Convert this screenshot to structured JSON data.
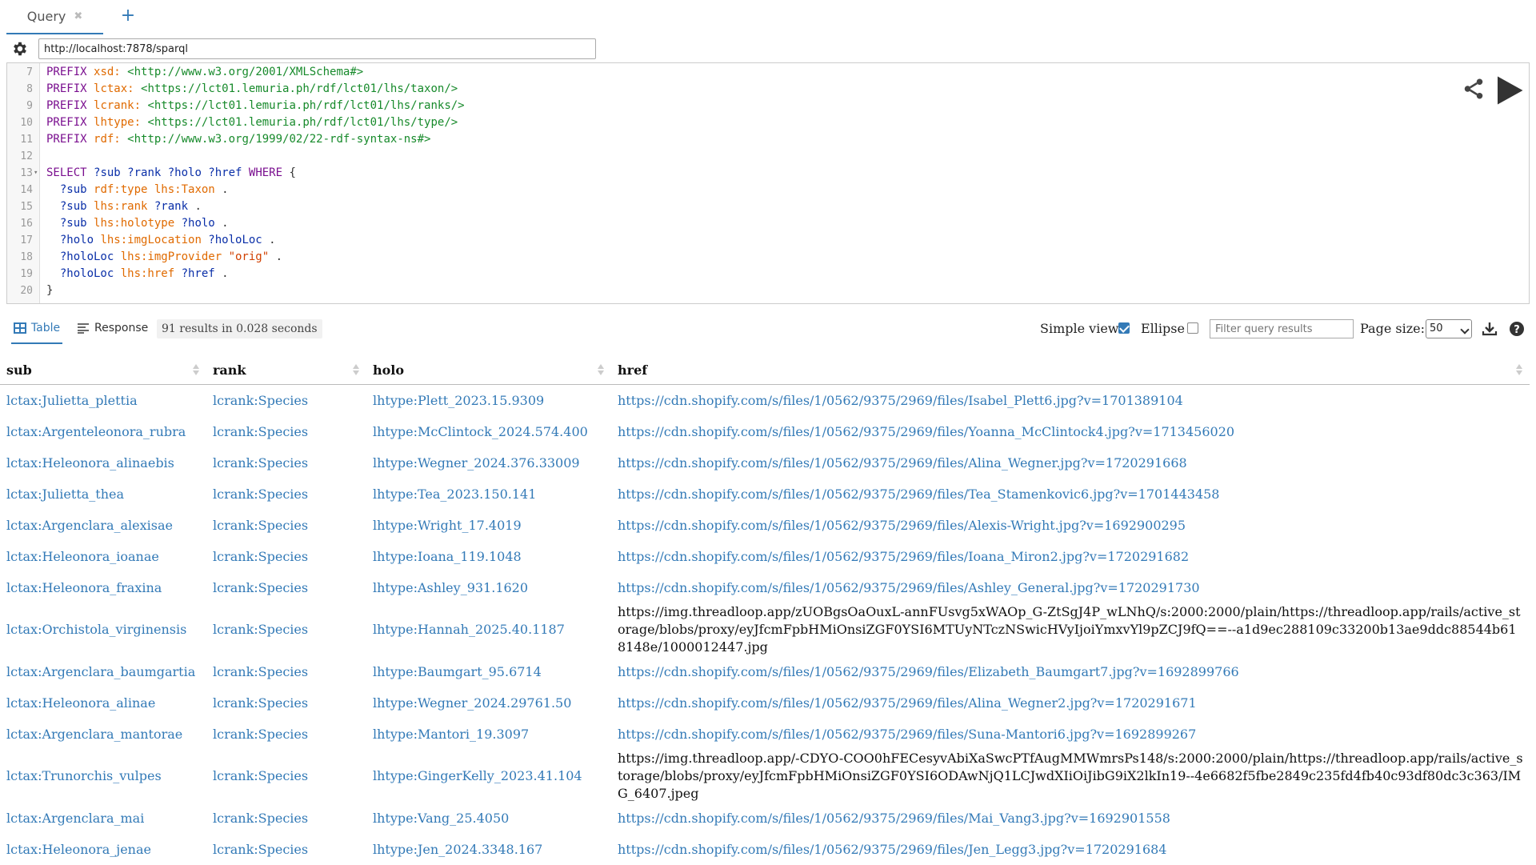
{
  "tabs": [
    {
      "label": "Query",
      "close": "✖"
    }
  ],
  "add_tab": "+",
  "endpoint": "http://localhost:7878/sparql",
  "editor": {
    "lines": [
      {
        "n": "7",
        "tokens": [
          [
            "kw",
            "PREFIX "
          ],
          [
            "pf",
            "xsd: "
          ],
          [
            "uri",
            "<http://www.w3.org/2001/XMLSchema#>"
          ]
        ]
      },
      {
        "n": "8",
        "tokens": [
          [
            "kw",
            "PREFIX "
          ],
          [
            "pf",
            "lctax: "
          ],
          [
            "uri",
            "<https://lct01.lemuria.ph/rdf/lct01/lhs/taxon/>"
          ]
        ]
      },
      {
        "n": "9",
        "tokens": [
          [
            "kw",
            "PREFIX "
          ],
          [
            "pf",
            "lcrank: "
          ],
          [
            "uri",
            "<https://lct01.lemuria.ph/rdf/lct01/lhs/ranks/>"
          ]
        ]
      },
      {
        "n": "10",
        "tokens": [
          [
            "kw",
            "PREFIX "
          ],
          [
            "pf",
            "lhtype: "
          ],
          [
            "uri",
            "<https://lct01.lemuria.ph/rdf/lct01/lhs/type/>"
          ]
        ]
      },
      {
        "n": "11",
        "tokens": [
          [
            "kw",
            "PREFIX "
          ],
          [
            "pf",
            "rdf: "
          ],
          [
            "uri",
            "<http://www.w3.org/1999/02/22-rdf-syntax-ns#>"
          ]
        ]
      },
      {
        "n": "12",
        "tokens": []
      },
      {
        "n": "13",
        "fold": true,
        "tokens": [
          [
            "kw",
            "SELECT "
          ],
          [
            "var",
            "?sub ?rank ?holo ?href "
          ],
          [
            "kw",
            "WHERE "
          ],
          [
            "txt",
            "{"
          ]
        ]
      },
      {
        "n": "14",
        "tokens": [
          [
            "txt",
            "  "
          ],
          [
            "var",
            "?sub "
          ],
          [
            "pf",
            "rdf:type lhs:Taxon "
          ],
          [
            "txt",
            "."
          ]
        ]
      },
      {
        "n": "15",
        "tokens": [
          [
            "txt",
            "  "
          ],
          [
            "var",
            "?sub "
          ],
          [
            "pf",
            "lhs:rank "
          ],
          [
            "var",
            "?rank "
          ],
          [
            "txt",
            "."
          ]
        ]
      },
      {
        "n": "16",
        "tokens": [
          [
            "txt",
            "  "
          ],
          [
            "var",
            "?sub "
          ],
          [
            "pf",
            "lhs:holotype "
          ],
          [
            "var",
            "?holo "
          ],
          [
            "txt",
            "."
          ]
        ]
      },
      {
        "n": "17",
        "tokens": [
          [
            "txt",
            "  "
          ],
          [
            "var",
            "?holo "
          ],
          [
            "pf",
            "lhs:imgLocation "
          ],
          [
            "var",
            "?holoLoc "
          ],
          [
            "txt",
            "."
          ]
        ]
      },
      {
        "n": "18",
        "tokens": [
          [
            "txt",
            "  "
          ],
          [
            "var",
            "?holoLoc "
          ],
          [
            "pf",
            "lhs:imgProvider "
          ],
          [
            "str",
            "\"orig\" "
          ],
          [
            "txt",
            "."
          ]
        ]
      },
      {
        "n": "19",
        "tokens": [
          [
            "txt",
            "  "
          ],
          [
            "var",
            "?holoLoc "
          ],
          [
            "pf",
            "lhs:href "
          ],
          [
            "var",
            "?href "
          ],
          [
            "txt",
            "."
          ]
        ]
      },
      {
        "n": "20",
        "tokens": [
          [
            "txt",
            "}"
          ]
        ]
      }
    ]
  },
  "results_bar": {
    "table_label": "Table",
    "response_label": "Response",
    "summary": "91 results in 0.028 seconds",
    "simple_view_label": "Simple view",
    "simple_view_checked": true,
    "ellipse_label": "Ellipse",
    "ellipse_checked": false,
    "filter_placeholder": "Filter query results",
    "page_size_label": "Page size:",
    "page_size_value": "50"
  },
  "table": {
    "columns": [
      "sub",
      "rank",
      "holo",
      "href"
    ],
    "rows": [
      {
        "sub": "lctax:Julietta_plettia",
        "rank": "lcrank:Species",
        "holo": "lhtype:Plett_2023.15.9309",
        "href": "https://cdn.shopify.com/s/files/1/0562/9375/2969/files/Isabel_Plett6.jpg?v=1701389104",
        "href_link": true
      },
      {
        "sub": "lctax:Argenteleonora_rubra",
        "rank": "lcrank:Species",
        "holo": "lhtype:McClintock_2024.574.400",
        "href": "https://cdn.shopify.com/s/files/1/0562/9375/2969/files/Yoanna_McClintock4.jpg?v=1713456020",
        "href_link": true
      },
      {
        "sub": "lctax:Heleonora_alinaebis",
        "rank": "lcrank:Species",
        "holo": "lhtype:Wegner_2024.376.33009",
        "href": "https://cdn.shopify.com/s/files/1/0562/9375/2969/files/Alina_Wegner.jpg?v=1720291668",
        "href_link": true
      },
      {
        "sub": "lctax:Julietta_thea",
        "rank": "lcrank:Species",
        "holo": "lhtype:Tea_2023.150.141",
        "href": "https://cdn.shopify.com/s/files/1/0562/9375/2969/files/Tea_Stamenkovic6.jpg?v=1701443458",
        "href_link": true
      },
      {
        "sub": "lctax:Argenclara_alexisae",
        "rank": "lcrank:Species",
        "holo": "lhtype:Wright_17.4019",
        "href": "https://cdn.shopify.com/s/files/1/0562/9375/2969/files/Alexis-Wright.jpg?v=1692900295",
        "href_link": true
      },
      {
        "sub": "lctax:Heleonora_ioanae",
        "rank": "lcrank:Species",
        "holo": "lhtype:Ioana_119.1048",
        "href": "https://cdn.shopify.com/s/files/1/0562/9375/2969/files/Ioana_Miron2.jpg?v=1720291682",
        "href_link": true
      },
      {
        "sub": "lctax:Heleonora_fraxina",
        "rank": "lcrank:Species",
        "holo": "lhtype:Ashley_931.1620",
        "href": "https://cdn.shopify.com/s/files/1/0562/9375/2969/files/Ashley_General.jpg?v=1720291730",
        "href_link": true
      },
      {
        "sub": "lctax:Orchistola_virginensis",
        "rank": "lcrank:Species",
        "holo": "lhtype:Hannah_2025.40.1187",
        "href": "https://img.threadloop.app/zUOBgsOaOuxL-annFUsvg5xWAOp_G-ZtSgJ4P_wLNhQ/s:2000:2000/plain/https://threadloop.app/rails/active_storage/blobs/proxy/eyJfcmFpbHMiOnsiZGF0YSI6MTUyNTczNSwicHVyIjoiYmxvYl9pZCJ9fQ==--a1d9ec288109c33200b13ae9ddc88544b618148e/1000012447.jpg",
        "href_link": false
      },
      {
        "sub": "lctax:Argenclara_baumgartia",
        "rank": "lcrank:Species",
        "holo": "lhtype:Baumgart_95.6714",
        "href": "https://cdn.shopify.com/s/files/1/0562/9375/2969/files/Elizabeth_Baumgart7.jpg?v=1692899766",
        "href_link": true
      },
      {
        "sub": "lctax:Heleonora_alinae",
        "rank": "lcrank:Species",
        "holo": "lhtype:Wegner_2024.29761.50",
        "href": "https://cdn.shopify.com/s/files/1/0562/9375/2969/files/Alina_Wegner2.jpg?v=1720291671",
        "href_link": true
      },
      {
        "sub": "lctax:Argenclara_mantorae",
        "rank": "lcrank:Species",
        "holo": "lhtype:Mantori_19.3097",
        "href": "https://cdn.shopify.com/s/files/1/0562/9375/2969/files/Suna-Mantori6.jpg?v=1692899267",
        "href_link": true
      },
      {
        "sub": "lctax:Trunorchis_vulpes",
        "rank": "lcrank:Species",
        "holo": "lhtype:GingerKelly_2023.41.104",
        "href": "https://img.threadloop.app/-CDYO-COO0hFECesyvAbiXaSwcPTfAugMMWmrsPs148/s:2000:2000/plain/https://threadloop.app/rails/active_storage/blobs/proxy/eyJfcmFpbHMiOnsiZGF0YSI6ODAwNjQ1LCJwdXIiOiJibG9iX2lkIn19--4e6682f5fbe2849c235fd4fb40c93df80dc3c363/IMG_6407.jpeg",
        "href_link": false
      },
      {
        "sub": "lctax:Argenclara_mai",
        "rank": "lcrank:Species",
        "holo": "lhtype:Vang_25.4050",
        "href": "https://cdn.shopify.com/s/files/1/0562/9375/2969/files/Mai_Vang3.jpg?v=1692901558",
        "href_link": true
      },
      {
        "sub": "lctax:Heleonora_jenae",
        "rank": "lcrank:Species",
        "holo": "lhtype:Jen_2024.3348.167",
        "href": "https://cdn.shopify.com/s/files/1/0562/9375/2969/files/Jen_Legg3.jpg?v=1720291684",
        "href_link": true
      }
    ]
  },
  "colors": {
    "accent": "#337ab7",
    "keyword": "#7a0f8f",
    "prefix": "#e06a00",
    "uri": "#178a2b",
    "variable": "#0a2fa8",
    "string": "#d14000"
  },
  "icons": {
    "settings": "gear-icon",
    "share": "share-icon",
    "run": "play-icon",
    "table": "table-icon",
    "response": "list-icon",
    "download": "download-icon",
    "help": "help-icon",
    "sort": "sort-icon"
  }
}
